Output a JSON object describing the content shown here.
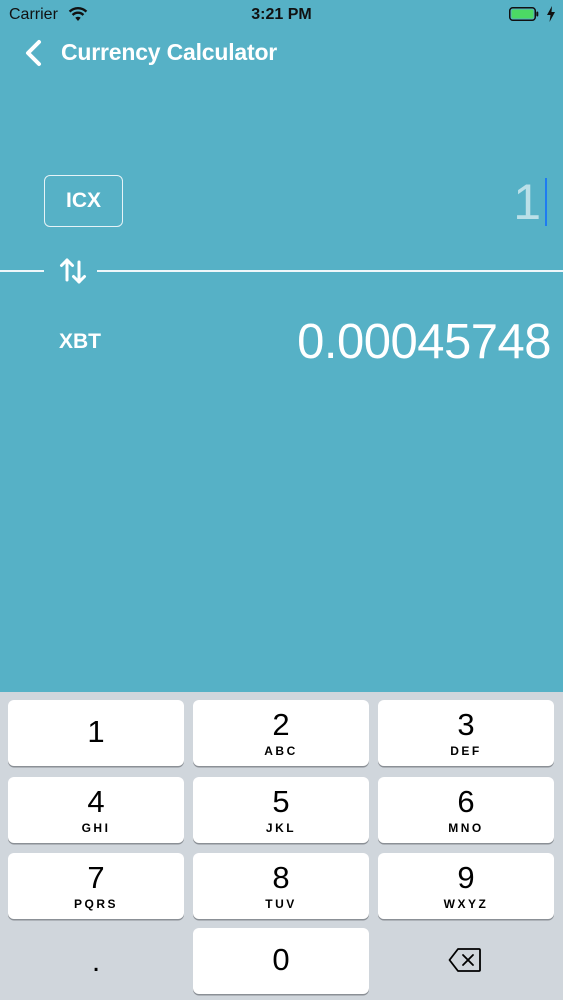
{
  "status_bar": {
    "carrier": "Carrier",
    "time": "3:21 PM"
  },
  "nav": {
    "back_icon": "chevron-left-icon",
    "title": "Currency Calculator"
  },
  "converter": {
    "from_currency": "ICX",
    "amount": "1",
    "swap_icon": "swap-arrows-icon",
    "to_currency": "XBT",
    "converted": "0.00045748"
  },
  "keypad": {
    "keys": [
      {
        "num": "1",
        "letters": ""
      },
      {
        "num": "2",
        "letters": "ABC"
      },
      {
        "num": "3",
        "letters": "DEF"
      },
      {
        "num": "4",
        "letters": "GHI"
      },
      {
        "num": "5",
        "letters": "JKL"
      },
      {
        "num": "6",
        "letters": "MNO"
      },
      {
        "num": "7",
        "letters": "PQRS"
      },
      {
        "num": "8",
        "letters": "TUV"
      },
      {
        "num": "9",
        "letters": "WXYZ"
      }
    ],
    "decimal": ".",
    "zero": "0",
    "delete_icon": "backspace-icon"
  },
  "colors": {
    "background": "#56b1c6",
    "keypad_background": "#d0d6dc",
    "caret": "#1e7bf2",
    "battery": "#4cd964"
  }
}
